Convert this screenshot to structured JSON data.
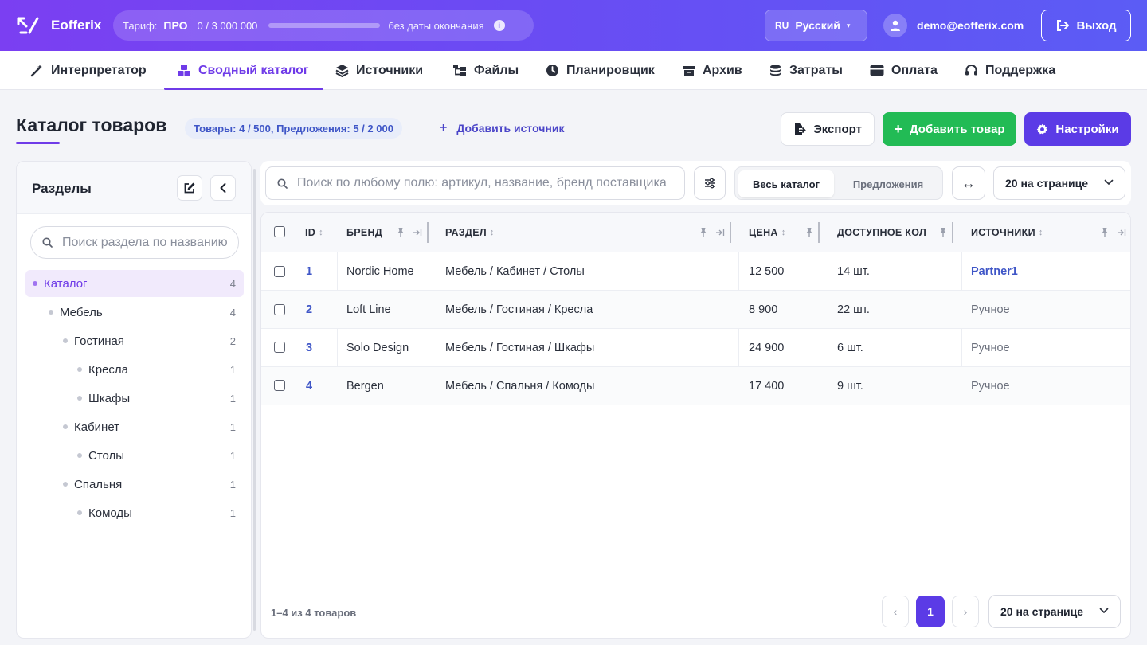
{
  "app": {
    "name": "Eofferix"
  },
  "plan": {
    "label": "Тариф:",
    "name": "ПРО",
    "usage": "0 / 3 000 000",
    "usage_fraction": 0.0,
    "expiry": "без даты окончания",
    "info_icon": "i"
  },
  "lang": {
    "code": "RU",
    "name": "Русский",
    "caret": "▾"
  },
  "user": {
    "email": "demo@eofferix.com"
  },
  "logout_label": "Выход",
  "nav": [
    {
      "label": "Интерпретатор",
      "icon": "magic-wand-icon"
    },
    {
      "label": "Сводный каталог",
      "icon": "boxes-icon",
      "active": true
    },
    {
      "label": "Источники",
      "icon": "layers-icon"
    },
    {
      "label": "Файлы",
      "icon": "folder-tree-icon"
    },
    {
      "label": "Планировщик",
      "icon": "clock-icon"
    },
    {
      "label": "Архив",
      "icon": "archive-icon"
    },
    {
      "label": "Затраты",
      "icon": "coins-icon"
    },
    {
      "label": "Оплата",
      "icon": "credit-card-icon"
    },
    {
      "label": "Поддержка",
      "icon": "headset-icon"
    }
  ],
  "page": {
    "title": "Каталог товаров",
    "stats": "Товары: 4 / 500, Предложения: 5 / 2 000",
    "add_source_plus": "+",
    "add_source": "Добавить источник",
    "export_label": "Экспорт",
    "add_product_label": "Добавить товар",
    "add_product_plus": "+",
    "settings_label": "Настройки"
  },
  "sidebar": {
    "title": "Разделы",
    "search_placeholder": "Поиск раздела по названию",
    "tree": [
      {
        "label": "Каталог",
        "count": "4",
        "level": 0,
        "active": true
      },
      {
        "label": "Мебель",
        "count": "4",
        "level": 1
      },
      {
        "label": "Гостиная",
        "count": "2",
        "level": 2
      },
      {
        "label": "Кресла",
        "count": "1",
        "level": 3
      },
      {
        "label": "Шкафы",
        "count": "1",
        "level": 3
      },
      {
        "label": "Кабинет",
        "count": "1",
        "level": 2
      },
      {
        "label": "Столы",
        "count": "1",
        "level": 3
      },
      {
        "label": "Спальня",
        "count": "1",
        "level": 2
      },
      {
        "label": "Комоды",
        "count": "1",
        "level": 3
      }
    ]
  },
  "toolbar": {
    "search_placeholder": "Поиск по любому полю: артикул, название, бренд поставщика",
    "view_all": "Весь каталог",
    "view_offers": "Предложения",
    "expand_glyph": "↔",
    "per_page": "20 на странице"
  },
  "table": {
    "columns": [
      "ID",
      "БРЕНД",
      "РАЗДЕЛ",
      "ЦЕНА",
      "ДОСТУПНОЕ КОЛ",
      "ИСТОЧНИКИ"
    ],
    "sort_glyph": "↕",
    "rows": [
      {
        "id": "1",
        "brand": "Nordic Home",
        "section": "Мебель / Кабинет / Столы",
        "price": "12 500",
        "qty": "14 шт.",
        "source": "Partner1",
        "source_link": true
      },
      {
        "id": "2",
        "brand": "Loft Line",
        "section": "Мебель / Гостиная / Кресла",
        "price": "8 900",
        "qty": "22 шт.",
        "source": "Ручное",
        "source_link": false
      },
      {
        "id": "3",
        "brand": "Solo Design",
        "section": "Мебель / Гостиная / Шкафы",
        "price": "24 900",
        "qty": "6 шт.",
        "source": "Ручное",
        "source_link": false
      },
      {
        "id": "4",
        "brand": "Bergen",
        "section": "Мебель / Спальня / Комоды",
        "price": "17 400",
        "qty": "9 шт.",
        "source": "Ручное",
        "source_link": false
      }
    ]
  },
  "footer": {
    "info": "1–4 из 4 товаров",
    "prev": "‹",
    "page": "1",
    "next": "›",
    "per_page": "20 на странице"
  },
  "colors": {
    "accent": "#6f3be8",
    "primary_button": "#5b3be6",
    "success": "#22bb55",
    "link": "#3f56c7"
  }
}
